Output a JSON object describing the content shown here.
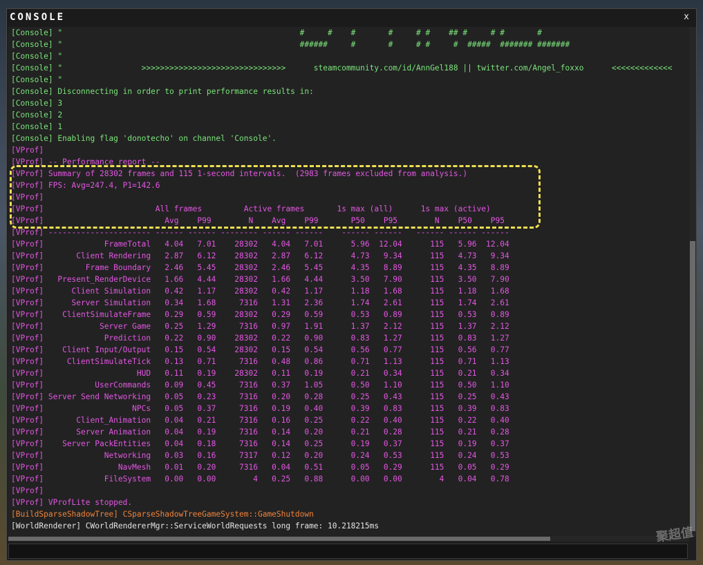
{
  "window": {
    "title": "CONSOLE",
    "close_label": "x"
  },
  "colors": {
    "console": "#7be37b",
    "vprof": "#e357e3",
    "build": "#f0833a",
    "world": "#e6e6e6",
    "highlight": "#f0e050"
  },
  "log": [
    {
      "type": "console",
      "text": "[Console] \"                                                   #     #    #       #     # #    ## #     # #       #"
    },
    {
      "type": "console",
      "text": "[Console] \"                                                   ######     #       #     # #     #  #####  ####### #######"
    },
    {
      "type": "console",
      "text": "[Console] \""
    },
    {
      "type": "console",
      "text": "[Console] \"                 >>>>>>>>>>>>>>>>>>>>>>>>>>>>>>>      steamcommunity.com/id/AnnGel188 || twitter.com/Angel_foxxo      <<<<<<<<<<<<<"
    },
    {
      "type": "console",
      "text": "[Console] \""
    },
    {
      "type": "console",
      "text": "[Console] Disconnecting in order to print performance results in:"
    },
    {
      "type": "console",
      "text": "[Console] 3"
    },
    {
      "type": "console",
      "text": "[Console] 2"
    },
    {
      "type": "console",
      "text": "[Console] 1"
    },
    {
      "type": "console",
      "text": "[Console] Enabling flag 'donotecho' on channel 'Console'."
    },
    {
      "type": "vprof",
      "text": "[VProf]"
    },
    {
      "type": "vprof",
      "text": "[VProf] -- Performance report --"
    },
    {
      "type": "vprof",
      "text": "[VProf] Summary of 28302 frames and 115 1-second intervals.  (2983 frames excluded from analysis.)"
    },
    {
      "type": "vprof",
      "text": "[VProf] FPS: Avg=247.4, P1=142.6"
    },
    {
      "type": "vprof",
      "text": "[VProf]"
    },
    {
      "type": "vprof",
      "text": "[VProf]                        All frames         Active frames       1s max (all)      1s max (active)"
    },
    {
      "type": "vprof",
      "text": "[VProf]                          Avg    P99        N    Avg    P99       P50    P95        N    P50    P95"
    },
    {
      "type": "vprof",
      "text": "[VProf] ---------------------- ------ ------ -------- ------ ------    ------ ------   ------ ------ ------"
    },
    {
      "type": "vprof",
      "text": "[VProf]             FrameTotal   4.04   7.01    28302   4.04   7.01      5.96  12.04      115   5.96  12.04"
    },
    {
      "type": "vprof",
      "text": "[VProf]       Client Rendering   2.87   6.12    28302   2.87   6.12      4.73   9.34      115   4.73   9.34"
    },
    {
      "type": "vprof",
      "text": "[VProf]         Frame Boundary   2.46   5.45    28302   2.46   5.45      4.35   8.89      115   4.35   8.89"
    },
    {
      "type": "vprof",
      "text": "[VProf]   Present_RenderDevice   1.66   4.44    28302   1.66   4.44      3.50   7.90      115   3.50   7.90"
    },
    {
      "type": "vprof",
      "text": "[VProf]      Client Simulation   0.42   1.17    28302   0.42   1.17      1.18   1.68      115   1.18   1.68"
    },
    {
      "type": "vprof",
      "text": "[VProf]      Server Simulation   0.34   1.68     7316   1.31   2.36      1.74   2.61      115   1.74   2.61"
    },
    {
      "type": "vprof",
      "text": "[VProf]    ClientSimulateFrame   0.29   0.59    28302   0.29   0.59      0.53   0.89      115   0.53   0.89"
    },
    {
      "type": "vprof",
      "text": "[VProf]            Server Game   0.25   1.29     7316   0.97   1.91      1.37   2.12      115   1.37   2.12"
    },
    {
      "type": "vprof",
      "text": "[VProf]             Prediction   0.22   0.90    28302   0.22   0.90      0.83   1.27      115   0.83   1.27"
    },
    {
      "type": "vprof",
      "text": "[VProf]    Client Input/Output   0.15   0.54    28302   0.15   0.54      0.56   0.77      115   0.56   0.77"
    },
    {
      "type": "vprof",
      "text": "[VProf]     ClientSimulateTick   0.13   0.71     7316   0.48   0.86      0.71   1.13      115   0.71   1.13"
    },
    {
      "type": "vprof",
      "text": "[VProf]                    HUD   0.11   0.19    28302   0.11   0.19      0.21   0.34      115   0.21   0.34"
    },
    {
      "type": "vprof",
      "text": "[VProf]           UserCommands   0.09   0.45     7316   0.37   1.05      0.50   1.10      115   0.50   1.10"
    },
    {
      "type": "vprof",
      "text": "[VProf] Server Send Networking   0.05   0.23     7316   0.20   0.28      0.25   0.43      115   0.25   0.43"
    },
    {
      "type": "vprof",
      "text": "[VProf]                   NPCs   0.05   0.37     7316   0.19   0.40      0.39   0.83      115   0.39   0.83"
    },
    {
      "type": "vprof",
      "text": "[VProf]       Client_Animation   0.04   0.21     7316   0.16   0.25      0.22   0.40      115   0.22   0.40"
    },
    {
      "type": "vprof",
      "text": "[VProf]       Server Animation   0.04   0.19     7316   0.14   0.20      0.21   0.28      115   0.21   0.28"
    },
    {
      "type": "vprof",
      "text": "[VProf]    Server PackEntities   0.04   0.18     7316   0.14   0.25      0.19   0.37      115   0.19   0.37"
    },
    {
      "type": "vprof",
      "text": "[VProf]             Networking   0.03   0.16     7317   0.12   0.20      0.24   0.53      115   0.24   0.53"
    },
    {
      "type": "vprof",
      "text": "[VProf]                NavMesh   0.01   0.20     7316   0.04   0.51      0.05   0.29      115   0.05   0.29"
    },
    {
      "type": "vprof",
      "text": "[VProf]             FileSystem   0.00   0.00        4   0.25   0.88      0.00   0.00        4   0.04   0.78"
    },
    {
      "type": "vprof",
      "text": "[VProf]"
    },
    {
      "type": "vprof",
      "text": "[VProf] VProfLite stopped."
    },
    {
      "type": "build",
      "text": "[BuildSparseShadowTree] CSparseShadowTreeGameSystem::GameShutdown"
    },
    {
      "type": "world",
      "text": "[WorldRenderer] CWorldRendererMgr::ServiceWorldRequests long frame: 10.218215ms"
    }
  ],
  "input": {
    "value": "",
    "placeholder": ""
  },
  "watermark": "聚超值"
}
